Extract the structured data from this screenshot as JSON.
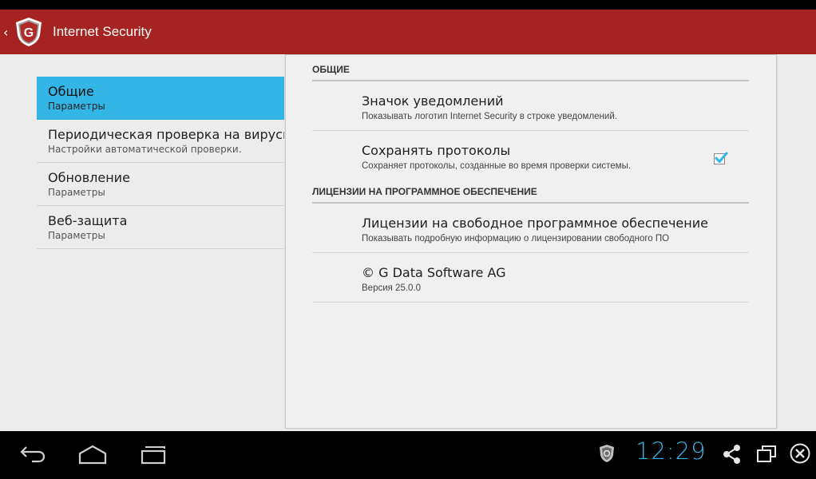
{
  "app": {
    "title": "Internet Security",
    "accent_color": "#a52422",
    "selection_color": "#33b5e5",
    "logo_icon": "g-data-shield-icon",
    "logo_letter": "G",
    "back_icon": "chevron-left-icon",
    "back_glyph": "‹"
  },
  "left_list": {
    "items": [
      {
        "title": "Общие",
        "subtitle": "Параметры",
        "selected": true
      },
      {
        "title": "Периодическая проверка на вирусы",
        "subtitle": "Настройки автоматической проверки.",
        "selected": false
      },
      {
        "title": "Обновление",
        "subtitle": "Параметры",
        "selected": false
      },
      {
        "title": "Веб-защита",
        "subtitle": "Параметры",
        "selected": false
      }
    ]
  },
  "right_panel": {
    "section_general": "ОБЩИЕ",
    "notification_icon": {
      "title": "Значок уведомлений",
      "subtitle": "Показывать логотип Internet Security в строке уведомлений."
    },
    "save_logs": {
      "title": "Сохранять протоколы",
      "subtitle": "Сохраняет протоколы, созданные во время проверки системы.",
      "checked": true
    },
    "section_licenses": "ЛИЦЕНЗИИ НА ПРОГРАММНОЕ ОБЕСПЕЧЕНИЕ",
    "free_licenses": {
      "title": "Лицензии на свободное программное обеспечение",
      "subtitle": "Показывать подробную информацию о лицензировании свободного ПО"
    },
    "about": {
      "title": "© G Data Software AG",
      "subtitle": "Версия 25.0.0"
    }
  },
  "system_bar": {
    "clock": "12:29",
    "clock_color": "#33b5e5",
    "icons": [
      "back-icon",
      "home-icon",
      "recent-apps-icon",
      "g-data-notification-icon",
      "share-icon",
      "screen-icon",
      "close-circle-icon"
    ]
  }
}
